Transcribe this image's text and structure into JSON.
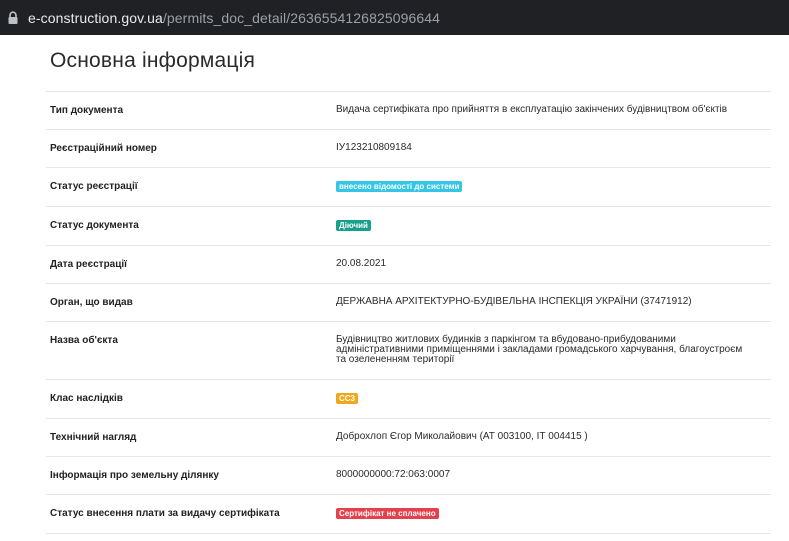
{
  "browser": {
    "url_host": "e-construction.gov.ua",
    "url_path": "/permits_doc_detail/2636554126825096644"
  },
  "page": {
    "title": "Основна інформація"
  },
  "rows": [
    {
      "label": "Тип документа",
      "value": "Видача сертифіката про прийняття в експлуатацію закінчених будівництвом об'єктів"
    },
    {
      "label": "Реєстраційний номер",
      "value": "ІУ123210809184"
    },
    {
      "label": "Статус реєстрації",
      "badge": "внесено відомості до системи",
      "badge_color": "#33c6e6"
    },
    {
      "label": "Статус документа",
      "badge": "Діючий",
      "badge_color": "#17a08a"
    },
    {
      "label": "Дата реєстрації",
      "value": "20.08.2021"
    },
    {
      "label": "Орган, що видав",
      "value": "ДЕРЖАВНА АРХІТЕКТУРНО-БУДІВЕЛЬНА ІНСПЕКЦІЯ УКРАЇНИ (37471912)"
    },
    {
      "label": "Назва об'єкта",
      "value_lines": [
        "Будівництво житлових будинків з паркінгом та вбудовано-прибудованими",
        "адміністративними приміщеннями і закладами громадського харчування, благоустроєм",
        "та озелененням території"
      ]
    },
    {
      "label": "Клас наслідків",
      "badge": "СС3",
      "badge_color": "#efa81a"
    },
    {
      "label": "Технічний нагляд",
      "value": "Доброхлоп Єгор Миколайович (АТ 003100, ІТ 004415 )"
    },
    {
      "label": "Інформація про земельну ділянку",
      "value": "8000000000:72:063:0007"
    },
    {
      "label": "Статус внесення плати за видачу сертифіката",
      "badge": "Сертифікат не сплачено",
      "badge_color": "#e5404d"
    }
  ]
}
